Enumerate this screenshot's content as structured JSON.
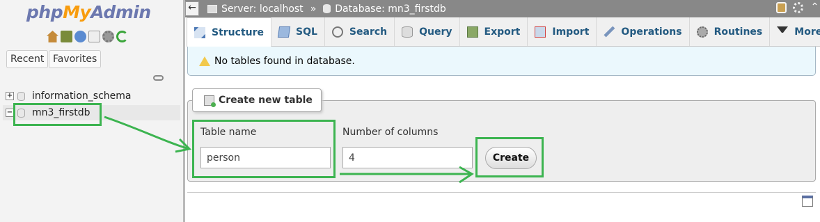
{
  "nav": {
    "logo_php": "php",
    "logo_my": "My",
    "logo_admin": "Admin",
    "recent_label": "Recent",
    "favorites_label": "Favorites",
    "databases": [
      {
        "name": "information_schema",
        "expander": "+"
      },
      {
        "name": "mn3_firstdb",
        "expander": "−"
      }
    ]
  },
  "topbar": {
    "back_label": "←",
    "server_crumb": "Server: localhost",
    "separator": "»",
    "database_crumb": "Database: mn3_firstdb"
  },
  "tabs": [
    {
      "label": "Structure",
      "icon": "structure-icon",
      "active": true
    },
    {
      "label": "SQL",
      "icon": "sql-icon"
    },
    {
      "label": "Search",
      "icon": "search-icon"
    },
    {
      "label": "Query",
      "icon": "query-icon"
    },
    {
      "label": "Export",
      "icon": "export-icon"
    },
    {
      "label": "Import",
      "icon": "import-icon"
    },
    {
      "label": "Operations",
      "icon": "wrench-icon"
    },
    {
      "label": "Routines",
      "icon": "routines-icon"
    },
    {
      "label": "More",
      "icon": "triangle-down-icon"
    }
  ],
  "notice": {
    "text": "No tables found in database."
  },
  "create_table": {
    "legend": "Create new table",
    "table_name_label": "Table name",
    "table_name_value": "person",
    "num_columns_label": "Number of columns",
    "num_columns_value": "4",
    "create_button": "Create"
  },
  "colors": {
    "highlight": "#3cb450",
    "topbar": "#888888",
    "tab_text": "#235a81",
    "notice_bg": "#ebf8fd"
  }
}
